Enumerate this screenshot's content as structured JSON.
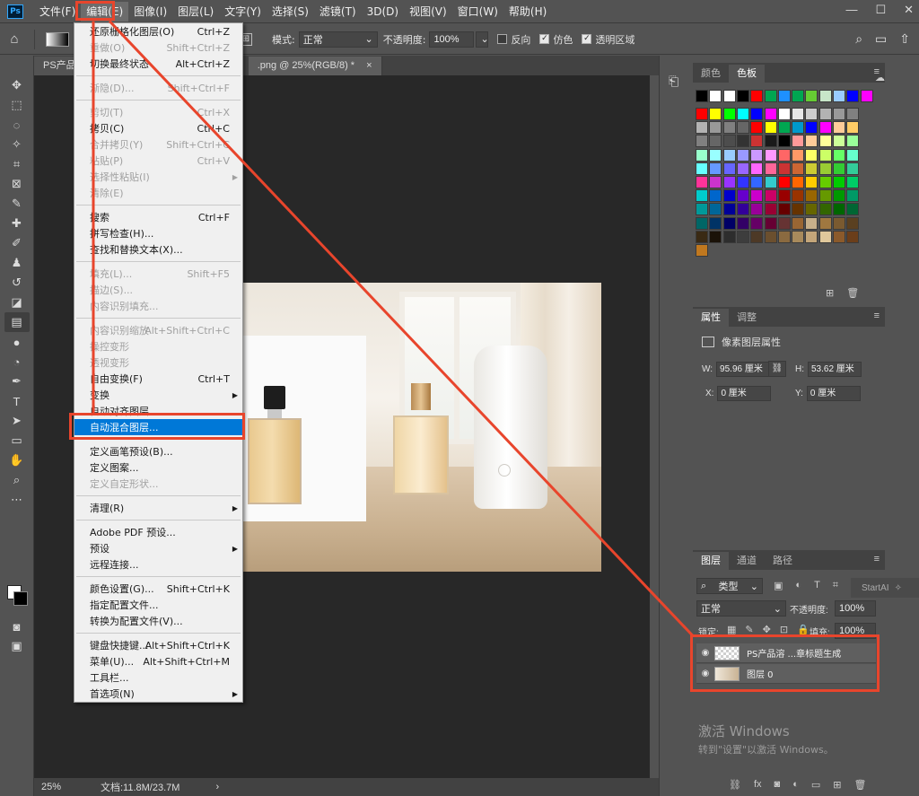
{
  "menubar": {
    "logo": "Ps",
    "items": [
      "文件(F)",
      "编辑(E)",
      "图像(I)",
      "图层(L)",
      "文字(Y)",
      "选择(S)",
      "滤镜(T)",
      "3D(D)",
      "视图(V)",
      "窗口(W)",
      "帮助(H)"
    ],
    "active_index": 1,
    "window_controls": [
      "—",
      "☐",
      "✕"
    ]
  },
  "options": {
    "mode_label": "模式:",
    "mode_value": "正常",
    "opacity_label": "不透明度:",
    "opacity_value": "100%",
    "reverse_label": "反向",
    "dither_label": "仿色",
    "transparency_label": "透明区域"
  },
  "tabs": {
    "tab1": "PS产品海",
    "tab2": ".png @ 25%(RGB/8) *",
    "tab2_close": "×"
  },
  "status": {
    "zoom": "25%",
    "doc": "文档:11.8M/23.7M",
    "arrow": "›"
  },
  "edit_menu": [
    {
      "label": "还原栅格化图层(O)",
      "shortcut": "Ctrl+Z",
      "disabled": false
    },
    {
      "label": "重做(O)",
      "shortcut": "Shift+Ctrl+Z",
      "disabled": true
    },
    {
      "label": "切换最终状态",
      "shortcut": "Alt+Ctrl+Z",
      "disabled": false
    },
    {
      "label": "渐隐(D)...",
      "shortcut": "Shift+Ctrl+F",
      "disabled": true
    },
    {
      "label": "剪切(T)",
      "shortcut": "Ctrl+X",
      "disabled": true
    },
    {
      "label": "拷贝(C)",
      "shortcut": "Ctrl+C",
      "disabled": false
    },
    {
      "label": "合并拷贝(Y)",
      "shortcut": "Shift+Ctrl+C",
      "disabled": true
    },
    {
      "label": "粘贴(P)",
      "shortcut": "Ctrl+V",
      "disabled": true
    },
    {
      "label": "选择性粘贴(I)",
      "shortcut": "",
      "disabled": true,
      "submenu": true
    },
    {
      "label": "清除(E)",
      "shortcut": "",
      "disabled": true
    },
    {
      "label": "搜索",
      "shortcut": "Ctrl+F",
      "disabled": false
    },
    {
      "label": "拼写检查(H)...",
      "shortcut": "",
      "disabled": false
    },
    {
      "label": "查找和替换文本(X)...",
      "shortcut": "",
      "disabled": false
    },
    {
      "label": "填充(L)...",
      "shortcut": "Shift+F5",
      "disabled": true
    },
    {
      "label": "描边(S)...",
      "shortcut": "",
      "disabled": true
    },
    {
      "label": "内容识别填充...",
      "shortcut": "",
      "disabled": true
    },
    {
      "label": "内容识别缩放",
      "shortcut": "Alt+Shift+Ctrl+C",
      "disabled": true
    },
    {
      "label": "操控变形",
      "shortcut": "",
      "disabled": true
    },
    {
      "label": "透视变形",
      "shortcut": "",
      "disabled": true
    },
    {
      "label": "自由变换(F)",
      "shortcut": "Ctrl+T",
      "disabled": false
    },
    {
      "label": "变换",
      "shortcut": "",
      "disabled": false,
      "submenu": true
    },
    {
      "label": "自动对齐图层...",
      "shortcut": "",
      "disabled": false
    },
    {
      "label": "自动混合图层...",
      "shortcut": "",
      "disabled": false,
      "highlighted": true
    },
    {
      "label": "定义画笔预设(B)...",
      "shortcut": "",
      "disabled": false
    },
    {
      "label": "定义图案...",
      "shortcut": "",
      "disabled": false
    },
    {
      "label": "定义自定形状...",
      "shortcut": "",
      "disabled": true
    },
    {
      "label": "清理(R)",
      "shortcut": "",
      "disabled": false,
      "submenu": true
    },
    {
      "label": "Adobe PDF 预设...",
      "shortcut": "",
      "disabled": false
    },
    {
      "label": "预设",
      "shortcut": "",
      "disabled": false,
      "submenu": true
    },
    {
      "label": "远程连接...",
      "shortcut": "",
      "disabled": false
    },
    {
      "label": "颜色设置(G)...",
      "shortcut": "Shift+Ctrl+K",
      "disabled": false
    },
    {
      "label": "指定配置文件...",
      "shortcut": "",
      "disabled": false
    },
    {
      "label": "转换为配置文件(V)...",
      "shortcut": "",
      "disabled": false
    },
    {
      "label": "键盘快捷键...",
      "shortcut": "Alt+Shift+Ctrl+K",
      "disabled": false
    },
    {
      "label": "菜单(U)...",
      "shortcut": "Alt+Shift+Ctrl+M",
      "disabled": false
    },
    {
      "label": "工具栏...",
      "shortcut": "",
      "disabled": false
    },
    {
      "label": "首选项(N)",
      "shortcut": "",
      "disabled": false,
      "submenu": true
    }
  ],
  "swatch_panel": {
    "tab_color": "颜色",
    "tab_swatches": "色板",
    "menu": "≡",
    "rows": [
      [
        "#000000",
        "#ffffff",
        "#ffffff",
        "#000000",
        "#ff0000",
        "#00a651",
        "#1e90ff",
        "#00a651",
        "#66cc33",
        "#c8e6c9",
        "#99ccff",
        "#0000ff",
        "#ff00ff"
      ],
      [
        "#ff0000",
        "#ffff00",
        "#00ff00",
        "#00ffff",
        "#0000ff",
        "#ff00ff",
        "#ffffff",
        "#e6e6e6",
        "#cccccc",
        "#b3b3b3",
        "#999999",
        "#808080"
      ],
      [
        "#b3b3b3",
        "#999999",
        "#808080",
        "#666666",
        "#ff0000",
        "#ffff00",
        "#00a651",
        "#0099cc",
        "#0000ff",
        "#ff00ff",
        "#ffcc99",
        "#ffcc66"
      ],
      [
        "#808080",
        "#666666",
        "#4d4d4d",
        "#333333",
        "#cc3333",
        "#1a1a1a",
        "#000000",
        "#ff9999",
        "#ffcc99",
        "#ffff99",
        "#ccff99",
        "#99ff99"
      ],
      [
        "#99ffcc",
        "#99ffff",
        "#99ccff",
        "#9999ff",
        "#cc99ff",
        "#ff99ff",
        "#ff6666",
        "#ff9966",
        "#ffff66",
        "#ccff66",
        "#66ff66",
        "#66ffcc"
      ],
      [
        "#66ffff",
        "#6699ff",
        "#6666ff",
        "#9966ff",
        "#ff66ff",
        "#ff6699",
        "#cc3333",
        "#cc6633",
        "#cccc33",
        "#99cc33",
        "#33cc33",
        "#33cc99"
      ],
      [
        "#ff3399",
        "#cc33cc",
        "#9933ff",
        "#3333ff",
        "#3366ff",
        "#33cccc",
        "#ff0000",
        "#ff6600",
        "#ffcc00",
        "#66cc00",
        "#00cc00",
        "#00cc66"
      ],
      [
        "#00cccc",
        "#0066cc",
        "#0000cc",
        "#6600cc",
        "#cc00cc",
        "#cc0066",
        "#990000",
        "#993300",
        "#996600",
        "#669900",
        "#009900",
        "#009966"
      ],
      [
        "#009999",
        "#006699",
        "#000099",
        "#330099",
        "#990099",
        "#990033",
        "#660000",
        "#663300",
        "#666600",
        "#336600",
        "#006600",
        "#006633"
      ],
      [
        "#006666",
        "#003366",
        "#000066",
        "#330066",
        "#660066",
        "#660033",
        "#663333",
        "#996633",
        "#c8b08a",
        "#a07840",
        "#7a5a30",
        "#5a4020"
      ],
      [
        "#3a2a14",
        "#1a1208",
        "#2d2d2d",
        "#3d3d3d",
        "#4d3926",
        "#6b4f2e",
        "#8a6a40",
        "#a88a5c",
        "#c4a67a",
        "#e0c89c",
        "#8b5a2b",
        "#6b3e1a"
      ],
      [
        "#c0781f"
      ]
    ]
  },
  "properties": {
    "tab_props": "属性",
    "tab_adjust": "调整",
    "menu": "≡",
    "title": "像素图层属性",
    "w_label": "W:",
    "w_value": "95.96 厘米",
    "h_label": "H:",
    "h_value": "53.62 厘米",
    "x_label": "X:",
    "x_value": "0 厘米",
    "y_label": "Y:",
    "y_value": "0 厘米"
  },
  "layers": {
    "tab_layers": "图层",
    "tab_channels": "通道",
    "tab_paths": "路径",
    "menu": "≡",
    "filter_label": "类型",
    "blend_mode": "正常",
    "opacity_label": "不透明度:",
    "opacity_value": "100%",
    "lock_label": "锁定:",
    "fill_label": "填充:",
    "fill_value": "100%",
    "items": [
      {
        "name": "PS产品溶 ...章标题生成",
        "thumb": "checker"
      },
      {
        "name": "图层 0",
        "thumb": "photo"
      }
    ],
    "startai": "StartAI"
  },
  "watermark": {
    "line1": "激活 Windows",
    "line2": "转到\"设置\"以激活 Windows。"
  }
}
